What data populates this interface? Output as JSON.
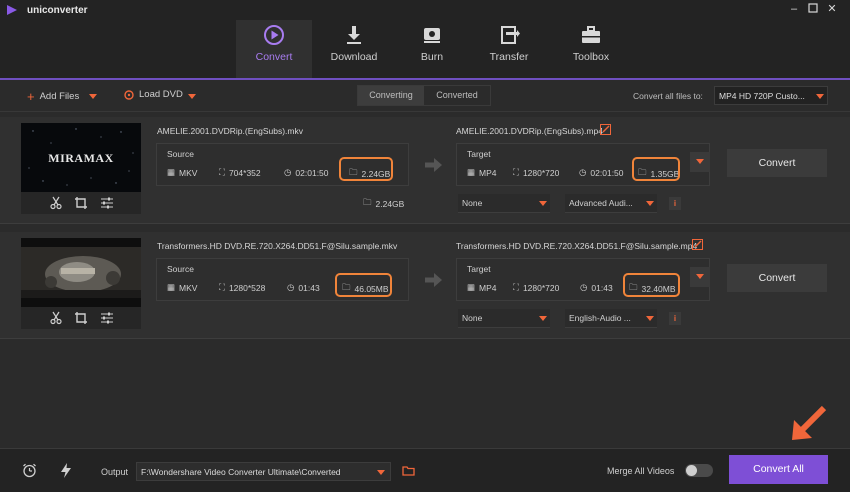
{
  "window": {
    "title": "uniconverter",
    "controls": [
      "minimize-icon",
      "maximize-icon",
      "close-icon"
    ]
  },
  "nav": {
    "tabs": [
      {
        "label": "Convert",
        "icon": "convert-icon",
        "active": true
      },
      {
        "label": "Download",
        "icon": "download-icon",
        "active": false
      },
      {
        "label": "Burn",
        "icon": "burn-icon",
        "active": false
      },
      {
        "label": "Transfer",
        "icon": "transfer-icon",
        "active": false
      },
      {
        "label": "Toolbox",
        "icon": "toolbox-icon",
        "active": false
      }
    ]
  },
  "toolbar": {
    "add_files": "Add Files",
    "load_dvd": "Load DVD",
    "tab_converting": "Converting",
    "tab_converted": "Converted",
    "convert_all_label": "Convert all files to:",
    "convert_all_value": "MP4 HD 720P Custo..."
  },
  "files": [
    {
      "thumb_text": "MIRAMAX",
      "source_name": "AMELIE.2001.DVDRip.(EngSubs).mkv",
      "source": {
        "label": "Source",
        "format": "MKV",
        "resolution": "704*352",
        "duration": "02:01:50",
        "size": "2.24GB"
      },
      "extra_size": "2.24GB",
      "target_name": "AMELIE.2001.DVDRip.(EngSubs).mp4",
      "target": {
        "label": "Target",
        "format": "MP4",
        "resolution": "1280*720",
        "duration": "02:01:50",
        "size": "1.35GB"
      },
      "subtitle": "None",
      "audio": "Advanced Audi...",
      "convert_label": "Convert"
    },
    {
      "thumb_text": "",
      "source_name": "Transformers.HD DVD.RE.720.X264.DD51.F@Silu.sample.mkv",
      "source": {
        "label": "Source",
        "format": "MKV",
        "resolution": "1280*528",
        "duration": "01:43",
        "size": "46.05MB"
      },
      "target_name": "Transformers.HD DVD.RE.720.X264.DD51.F@Silu.sample.mp4",
      "target": {
        "label": "Target",
        "format": "MP4",
        "resolution": "1280*720",
        "duration": "01:43",
        "size": "32.40MB"
      },
      "subtitle": "None",
      "audio": "English-Audio ...",
      "convert_label": "Convert"
    }
  ],
  "bottom": {
    "output_label": "Output",
    "output_path": "F:\\Wondershare Video Converter Ultimate\\Converted",
    "merge_label": "Merge All Videos",
    "merge_enabled": false,
    "convert_all": "Convert All"
  },
  "colors": {
    "accent": "#f0663a",
    "brand": "#7e4fd6",
    "highlight": "#f0843a",
    "active_tab": "#a87cf0"
  }
}
